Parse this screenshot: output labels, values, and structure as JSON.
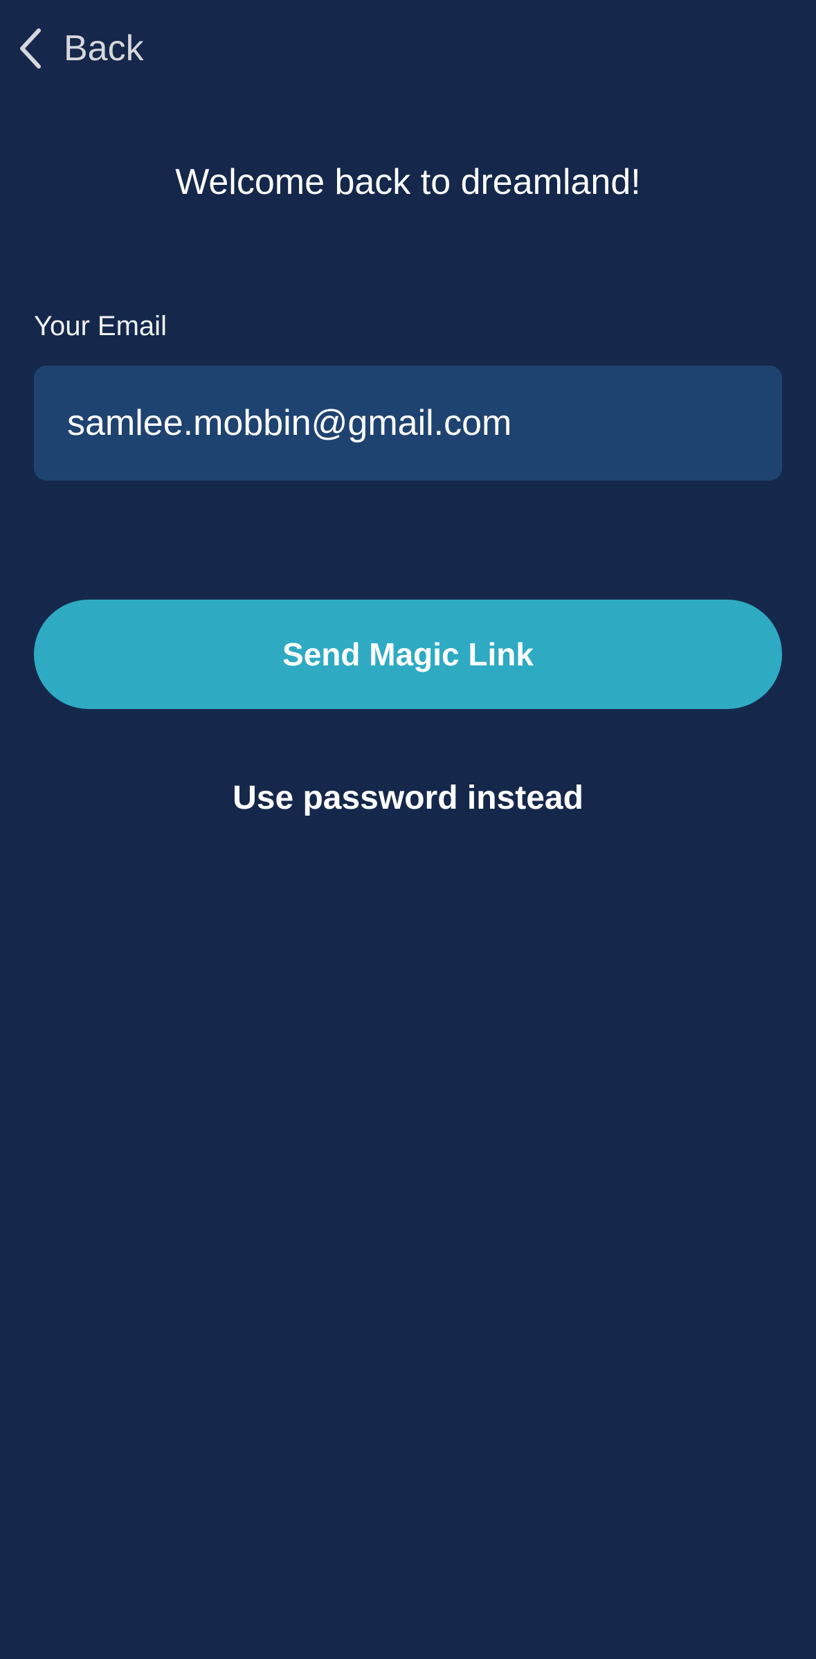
{
  "header": {
    "back_label": "Back",
    "back_icon": "chevron-left-icon"
  },
  "main": {
    "title": "Welcome back to dreamland!",
    "email_label": "Your Email",
    "email_value": "samlee.mobbin@gmail.com",
    "send_button_label": "Send Magic Link",
    "password_link_label": "Use password instead"
  },
  "colors": {
    "background": "#15284b",
    "input_background": "#1f4370",
    "accent": "#2eaac3",
    "text": "#ffffff",
    "back_text": "#d6d7dc"
  }
}
